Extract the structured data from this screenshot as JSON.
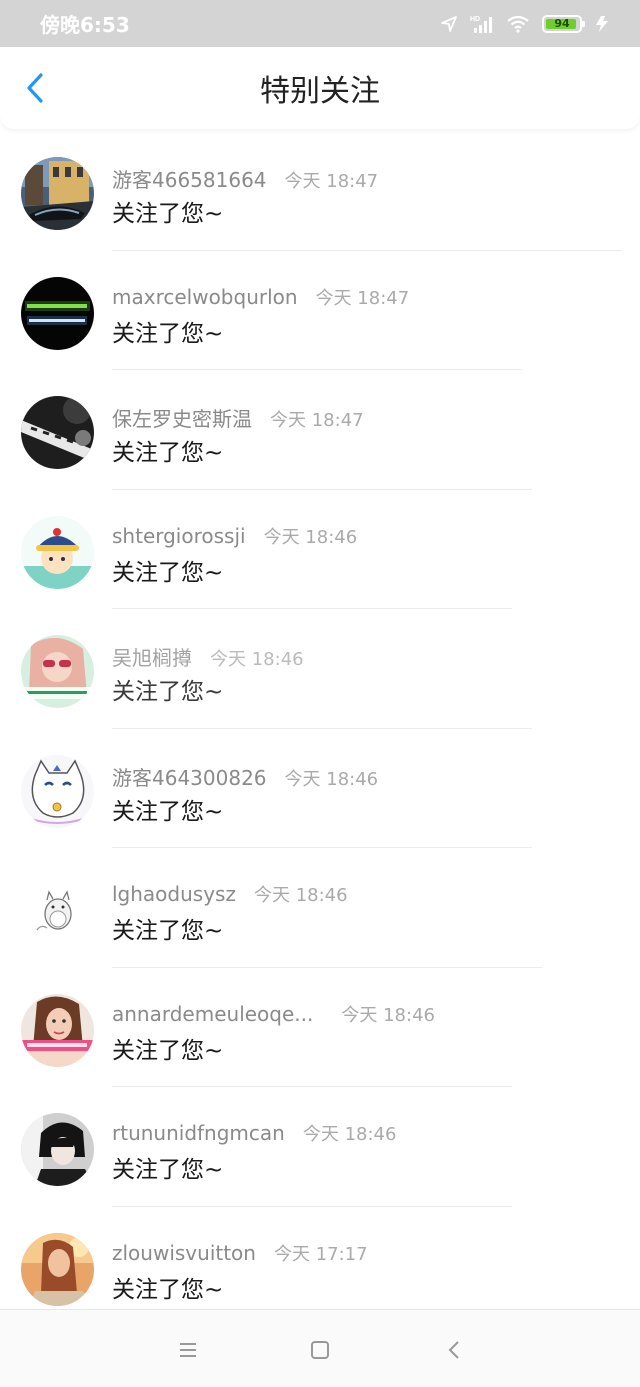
{
  "status_bar": {
    "time": "傍晚6:53",
    "battery_level": "94",
    "icons": [
      "location-icon",
      "hd-signal-icon",
      "wifi-icon",
      "battery-icon",
      "charging-icon"
    ]
  },
  "header": {
    "title": "特别关注",
    "back_icon": "chevron-left-icon",
    "accent_color": "#2196f3"
  },
  "list": {
    "items": [
      {
        "username": "游客466581664",
        "time": "今天 18:47",
        "message": "关注了您~",
        "avatar": "street-photo-avatar"
      },
      {
        "username": "maxrcelwobqurlon",
        "time": "今天 18:47",
        "message": "关注了您~",
        "avatar": "neon-text-avatar"
      },
      {
        "username": "保左罗史密斯温",
        "time": "今天 18:47",
        "message": "关注了您~",
        "avatar": "calligraphy-avatar"
      },
      {
        "username": "shtergiorossji",
        "time": "今天 18:46",
        "message": "关注了您~",
        "avatar": "cartoon-boy-avatar"
      },
      {
        "username": "吴旭榈撙",
        "time": "今天 18:46",
        "message": "关注了您~",
        "avatar": "girl-sunglasses-avatar"
      },
      {
        "username": "游客464300826",
        "time": "今天 18:46",
        "message": "关注了您~",
        "avatar": "cat-sketch-avatar"
      },
      {
        "username": "lghaodusysz",
        "time": "今天 18:46",
        "message": "关注了您~",
        "avatar": "totoro-avatar"
      },
      {
        "username": "annardemeuleoqe...",
        "time": "今天 18:46",
        "message": "关注了您~",
        "avatar": "woman-portrait-avatar"
      },
      {
        "username": "rtununidfngmcan",
        "time": "今天 18:46",
        "message": "关注了您~",
        "avatar": "anime-boy-avatar"
      },
      {
        "username": "zlouwisvuitton",
        "time": "今天 17:17",
        "message": "关注了您~",
        "avatar": "sunset-portrait-avatar"
      }
    ]
  },
  "system_nav": {
    "buttons": [
      "menu-icon",
      "home-icon",
      "back-icon"
    ]
  }
}
